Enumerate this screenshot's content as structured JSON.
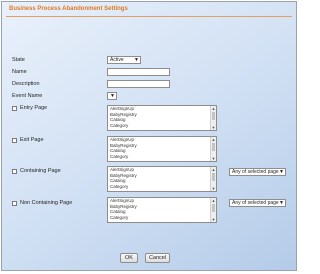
{
  "dialog": {
    "title": "Business Process Abandonment Settings"
  },
  "form": {
    "state": {
      "label": "State",
      "value": "Active"
    },
    "name": {
      "label": "Name",
      "value": ""
    },
    "description": {
      "label": "Description",
      "value": ""
    },
    "event_name": {
      "label": "Event Name",
      "value": ""
    },
    "entry_page": {
      "label": "Entry Page"
    },
    "exit_page": {
      "label": "Exit Page"
    },
    "containing_page": {
      "label": "Containing Page",
      "match": "Any of selected page"
    },
    "non_containing_page": {
      "label": "Non Containing Page",
      "match": "Any of selected page"
    },
    "page_options": [
      "AlertSignUp",
      "BabyRegistry",
      "Catalog",
      "Category"
    ]
  },
  "buttons": {
    "ok": "OK",
    "cancel": "Cancel"
  },
  "colors": {
    "title": "#e07a22",
    "background": "#cfdff3"
  }
}
